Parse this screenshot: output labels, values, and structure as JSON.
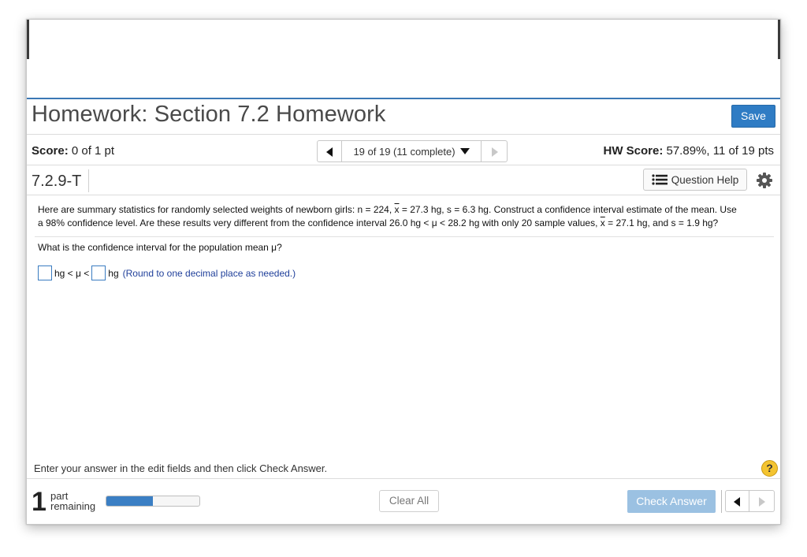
{
  "header": {
    "title": "Homework: Section 7.2 Homework",
    "save_label": "Save"
  },
  "score_bar": {
    "score_label": "Score:",
    "score_value": "0 of 1 pt",
    "nav_text": "19 of 19 (11 complete)",
    "hw_score_label": "HW Score:",
    "hw_score_value": "57.89%, 11 of 19 pts"
  },
  "question_bar": {
    "id": "7.2.9-T",
    "help_label": "Question Help"
  },
  "question": {
    "l1_a": "Here are summary statistics for randomly selected weights of newborn girls: n = 224, ",
    "l1_xbar": "x",
    "l1_b": " = 27.3 hg, s = 6.3 hg. Construct a confidence interval estimate of the mean. Use",
    "l2_a": "a 98% confidence level. Are these results very different from the confidence interval 26.0 hg < μ < 28.2 hg with only 20 sample values, ",
    "l2_xbar": "x",
    "l2_b": " = 27.1 hg, and s = 1.9 hg?",
    "prompt": "What is the confidence interval for the population mean μ?"
  },
  "answer": {
    "mid_text": "hg < μ <",
    "end_text": "hg",
    "hint": "(Round to one decimal place as needed.)"
  },
  "footer": {
    "instruction": "Enter your answer in the edit fields and then click Check Answer.",
    "help_symbol": "?",
    "parts_count": "1",
    "parts_word1": "part",
    "parts_word2": "remaining",
    "progress_fraction": 0.5,
    "clear_label": "Clear All",
    "check_label": "Check Answer"
  },
  "colors": {
    "accent": "#2f7cc4",
    "progress": "#3b7fc4",
    "check_disabled": "#9bc1e2",
    "hint_text": "#1f3f9a",
    "help_circle": "#f4c430"
  },
  "icons": {
    "nav_prev": "triangle-left-icon",
    "nav_dropdown": "caret-down-icon",
    "nav_next": "triangle-right-icon",
    "question_help": "list-icon",
    "settings": "gear-icon"
  }
}
